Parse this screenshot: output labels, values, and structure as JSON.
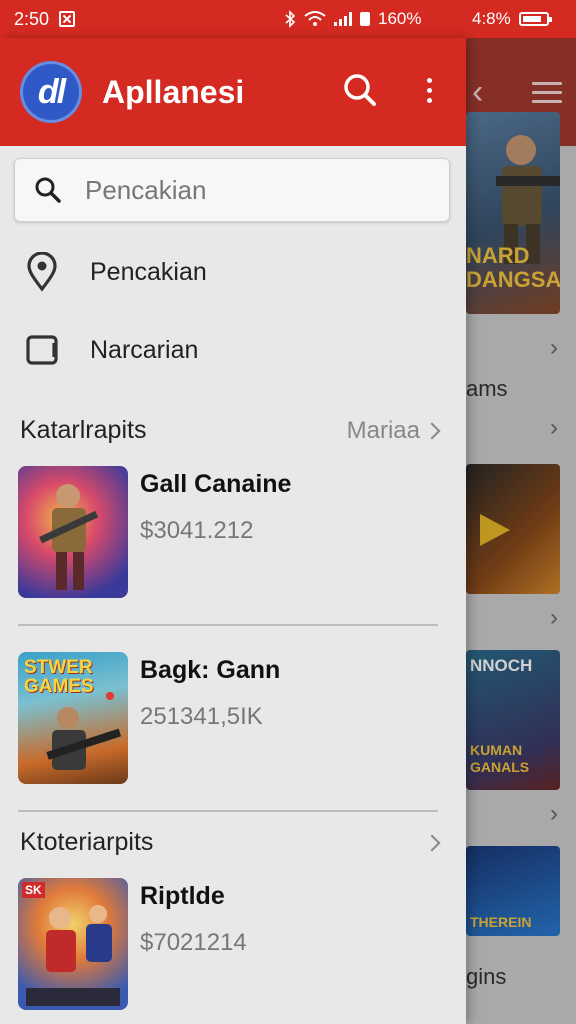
{
  "status_bar": {
    "time": "2:50",
    "battery_text": "160%",
    "other_battery_text": "4:8%"
  },
  "app": {
    "title": "Apllanesi",
    "logo_text": "dl"
  },
  "search": {
    "placeholder": "Pencakian"
  },
  "menu": [
    {
      "label": "Pencakian",
      "icon": "location-pin-icon"
    },
    {
      "label": "Narcarian",
      "icon": "tablet-icon"
    }
  ],
  "sections": [
    {
      "title": "Katarlrapits",
      "more_label": "Mariaa"
    },
    {
      "title": "Ktoteriarpits"
    }
  ],
  "items": [
    {
      "name": "Gall Canaine",
      "subtitle": "$3041.212"
    },
    {
      "name": "Bagk: Gann",
      "subtitle": "251341,5IK",
      "thumb_title_1": "STWER",
      "thumb_title_2": "GAMES"
    },
    {
      "name": "Riptlde",
      "subtitle": "$7021214",
      "thumb_badge": "SK"
    }
  ],
  "background_app": {
    "banner_1": "NARD",
    "banner_2": "DANGSA",
    "text_1": "ams",
    "tile_2_line_1": "NNOCH",
    "tile_2_line_2": "KUMAN",
    "tile_2_line_3": "GANALS",
    "tile_3_label": "THEREIN",
    "text_2": "gins"
  },
  "colors": {
    "primary": "#d42a22",
    "logo": "#2f59c6"
  }
}
